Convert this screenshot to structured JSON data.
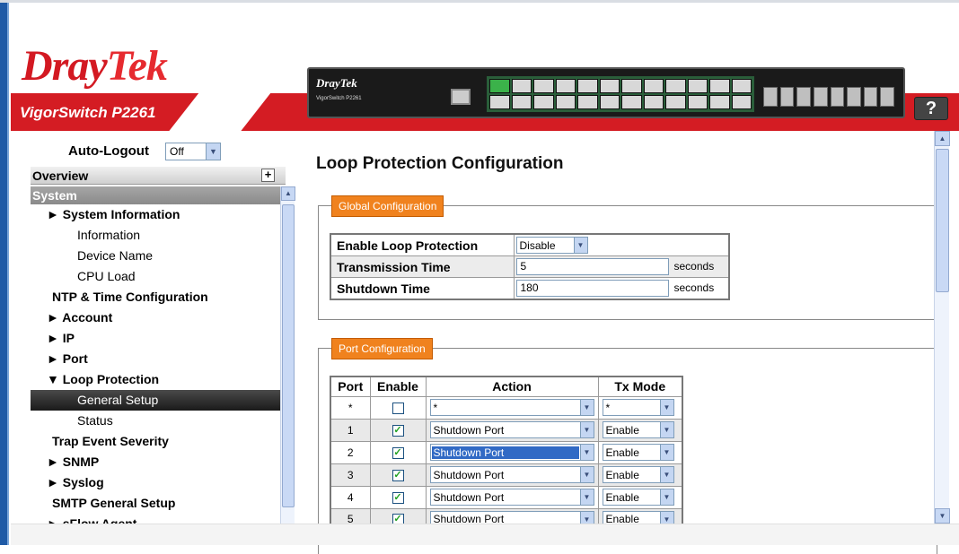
{
  "header": {
    "logo_dray": "Dray",
    "logo_tek": "Tek",
    "model": "VigorSwitch P2261",
    "device_brand": "DrayTek",
    "device_sub": "VigorSwitch P2261",
    "help_label": "?"
  },
  "sidebar": {
    "autologout_label": "Auto-Logout",
    "autologout_value": "Off",
    "overview_label": "Overview",
    "system_label": "System",
    "items": [
      {
        "label": "► System Information",
        "level": "l1",
        "bold": true
      },
      {
        "label": "Information",
        "level": "l2"
      },
      {
        "label": "Device Name",
        "level": "l2"
      },
      {
        "label": "CPU Load",
        "level": "l2"
      },
      {
        "label": "NTP & Time Configuration",
        "level": "lt"
      },
      {
        "label": "► Account",
        "level": "l1",
        "bold": true
      },
      {
        "label": "► IP",
        "level": "l1",
        "bold": true
      },
      {
        "label": "► Port",
        "level": "l1",
        "bold": true
      },
      {
        "label": "▼ Loop Protection",
        "level": "l1",
        "bold": true
      },
      {
        "label": "General Setup",
        "level": "l2",
        "active": true
      },
      {
        "label": "Status",
        "level": "l2"
      },
      {
        "label": "Trap Event Severity",
        "level": "lt"
      },
      {
        "label": "► SNMP",
        "level": "l1",
        "bold": true
      },
      {
        "label": "► Syslog",
        "level": "l1",
        "bold": true
      },
      {
        "label": "SMTP General Setup",
        "level": "lt"
      },
      {
        "label": "► sFlow Agent",
        "level": "l1",
        "bold": true
      }
    ]
  },
  "main": {
    "title": "Loop Protection Configuration",
    "global": {
      "legend": "Global Configuration",
      "enable_label": "Enable Loop Protection",
      "enable_value": "Disable",
      "tx_time_label": "Transmission Time",
      "tx_time_value": "5",
      "shutdown_label": "Shutdown Time",
      "shutdown_value": "180",
      "unit": "seconds"
    },
    "port": {
      "legend": "Port Configuration",
      "headers": {
        "port": "Port",
        "enable": "Enable",
        "action": "Action",
        "txmode": "Tx Mode"
      },
      "rows": [
        {
          "port": "*",
          "enabled": false,
          "action": "*",
          "tx": "*"
        },
        {
          "port": "1",
          "enabled": true,
          "action": "Shutdown Port",
          "tx": "Enable"
        },
        {
          "port": "2",
          "enabled": true,
          "action": "Shutdown Port",
          "tx": "Enable",
          "highlight": true
        },
        {
          "port": "3",
          "enabled": true,
          "action": "Shutdown Port",
          "tx": "Enable"
        },
        {
          "port": "4",
          "enabled": true,
          "action": "Shutdown Port",
          "tx": "Enable"
        },
        {
          "port": "5",
          "enabled": true,
          "action": "Shutdown Port",
          "tx": "Enable"
        }
      ]
    }
  },
  "icons": {
    "dropdown": "▼",
    "checkmark": "✓",
    "scroll_up": "▲",
    "scroll_down": "▼",
    "plus": "+"
  }
}
